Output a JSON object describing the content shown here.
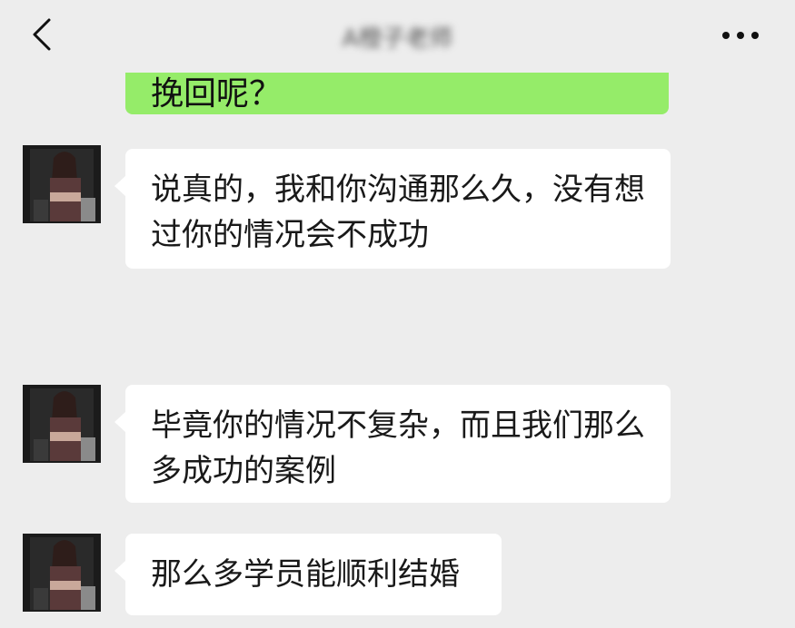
{
  "header": {
    "title": "A橙子老师",
    "back_icon": "chevron-left-icon",
    "more_icon": "more-dots-icon"
  },
  "messages": [
    {
      "direction": "outgoing",
      "text": "挽回呢？"
    },
    {
      "direction": "incoming",
      "text": "说真的，我和你沟通那么久，没有想过你的情况会不成功"
    },
    {
      "direction": "incoming",
      "text": "毕竟你的情况不复杂，而且我们那么多成功的案例"
    },
    {
      "direction": "incoming",
      "text": "那么多学员能顺利结婚"
    }
  ],
  "colors": {
    "background": "#ededed",
    "outgoing_bubble": "#95ec69",
    "incoming_bubble": "#ffffff"
  }
}
